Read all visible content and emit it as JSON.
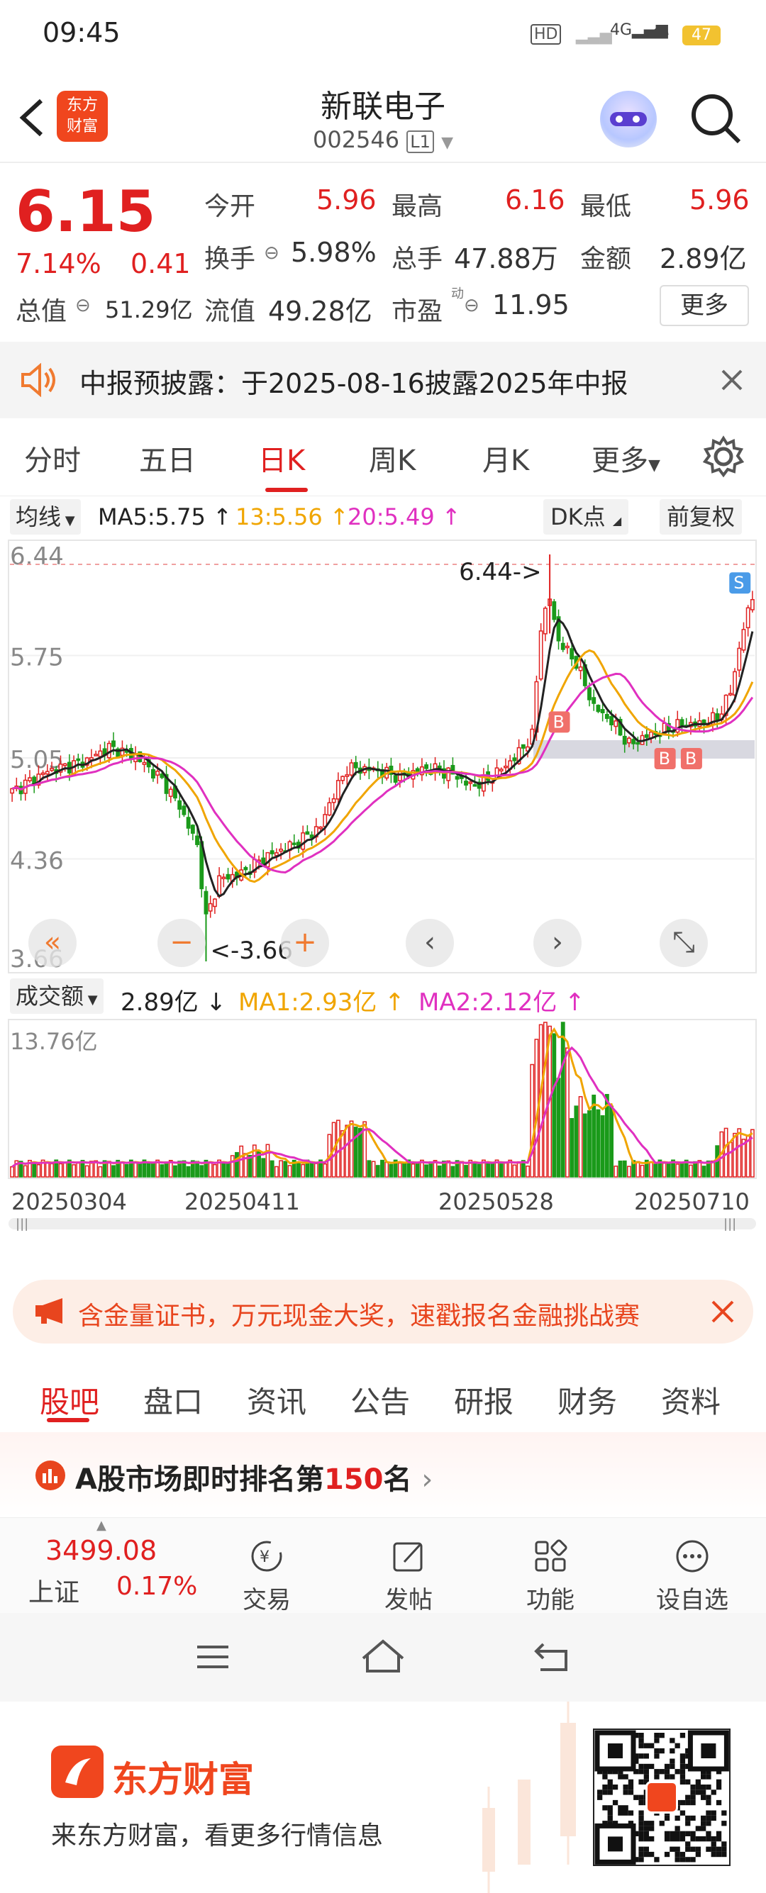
{
  "status": {
    "time": "09:45",
    "battery": "47"
  },
  "header": {
    "stock_name": "新联电子",
    "stock_code": "002546",
    "level": "L1"
  },
  "quote": {
    "price": "6.15",
    "change_pct": "7.14%",
    "change": "0.41",
    "open_label": "今开",
    "open": "5.96",
    "high_label": "最高",
    "high": "6.16",
    "low_label": "最低",
    "low": "5.96",
    "turnover_label": "换手",
    "turnover": "5.98%",
    "volume_label": "总手",
    "volume": "47.88万",
    "amount_label": "金额",
    "amount": "2.89亿",
    "mktcap_label": "总值",
    "mktcap": "51.29亿",
    "float_label": "流值",
    "float": "49.28亿",
    "pe_label": "市盈",
    "pe_sup": "动",
    "pe": "11.95",
    "more": "更多"
  },
  "notice": {
    "text": "中报预披露：于2025-08-16披露2025年中报"
  },
  "tabs": [
    "分时",
    "五日",
    "日K",
    "周K",
    "月K",
    "更多"
  ],
  "chart_bar": {
    "ma_type": "均线",
    "ma5": "MA5:5.75",
    "ma13": "13:5.56",
    "ma20": "20:5.49",
    "dk": "DK点",
    "adj": "前复权"
  },
  "vol_bar": {
    "label": "成交额",
    "value": "2.89亿",
    "ma1": "MA1:2.93亿",
    "ma2": "MA2:2.12亿",
    "max_label": "13.76亿"
  },
  "chart_data": {
    "type": "candlestick",
    "y_ticks": [
      "6.44",
      "5.75",
      "5.05",
      "4.36",
      "3.66"
    ],
    "ylim": [
      3.66,
      6.44
    ],
    "high_annotation": "6.44->",
    "low_annotation": "<-3.66",
    "x_labels": [
      "20250304",
      "20250411",
      "20250528",
      "20250710"
    ],
    "colors": {
      "up": "#e02020",
      "down": "#1a9a1a",
      "ma5": "#222222",
      "ma13": "#f0a500",
      "ma20": "#e030c0"
    }
  },
  "chart_buttons": [
    "«",
    "−",
    "+",
    "‹",
    "›",
    "⤡"
  ],
  "banner": {
    "text": "含金量证书，万元现金大奖，速戳报名金融挑战赛"
  },
  "subtabs": [
    "股吧",
    "盘口",
    "资讯",
    "公告",
    "研报",
    "财务",
    "资料"
  ],
  "rank": {
    "prefix": "A股市场即时排名第",
    "num": "150",
    "suffix": "名"
  },
  "bottom": {
    "index_value": "3499.08",
    "index_name": "上证",
    "index_pct": "0.17%",
    "trade": "交易",
    "post": "发帖",
    "func": "功能",
    "watch": "设自选"
  },
  "footer": {
    "brand": "东方财富",
    "slogan": "来东方财富，看更多行情信息",
    "logo_text": "东方财富"
  }
}
